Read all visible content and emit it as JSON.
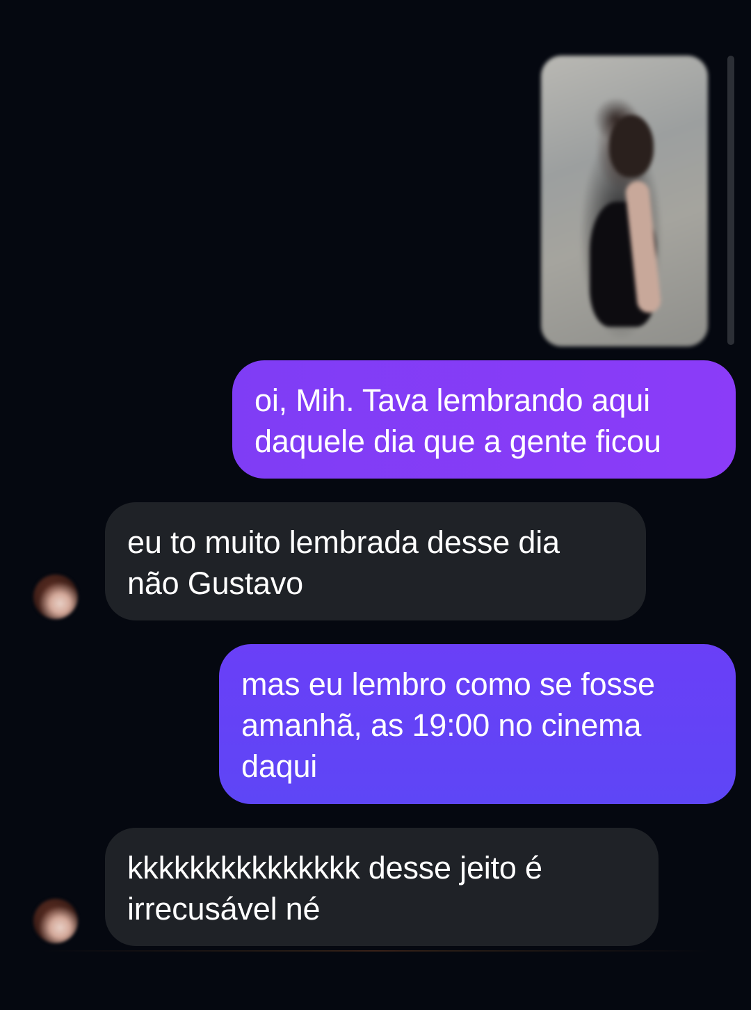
{
  "conversation": {
    "messages": [
      {
        "direction": "outgoing",
        "type": "image",
        "image_desc": "blurred-photo"
      },
      {
        "direction": "outgoing",
        "type": "text",
        "text": "oi, Mih. Tava lembrando aqui\ndaquele dia que a gente ficou"
      },
      {
        "direction": "incoming",
        "type": "text",
        "text": "eu to muito lembrada desse dia\nnão Gustavo"
      },
      {
        "direction": "outgoing",
        "type": "text",
        "text": "mas eu lembro como se fosse\namanhã, as 19:00 no cinema\ndaqui"
      },
      {
        "direction": "incoming",
        "type": "text",
        "text": "kkkkkkkkkkkkkkk desse jeito é\nirrecusável né"
      }
    ]
  },
  "colors": {
    "background": "#050810",
    "outgoing_bubble_start": "#7f3df5",
    "outgoing_bubble_end": "#5e46f6",
    "incoming_bubble": "#1f2227",
    "text": "#ffffff"
  },
  "icons": {
    "avatar": "contact-avatar-icon"
  }
}
